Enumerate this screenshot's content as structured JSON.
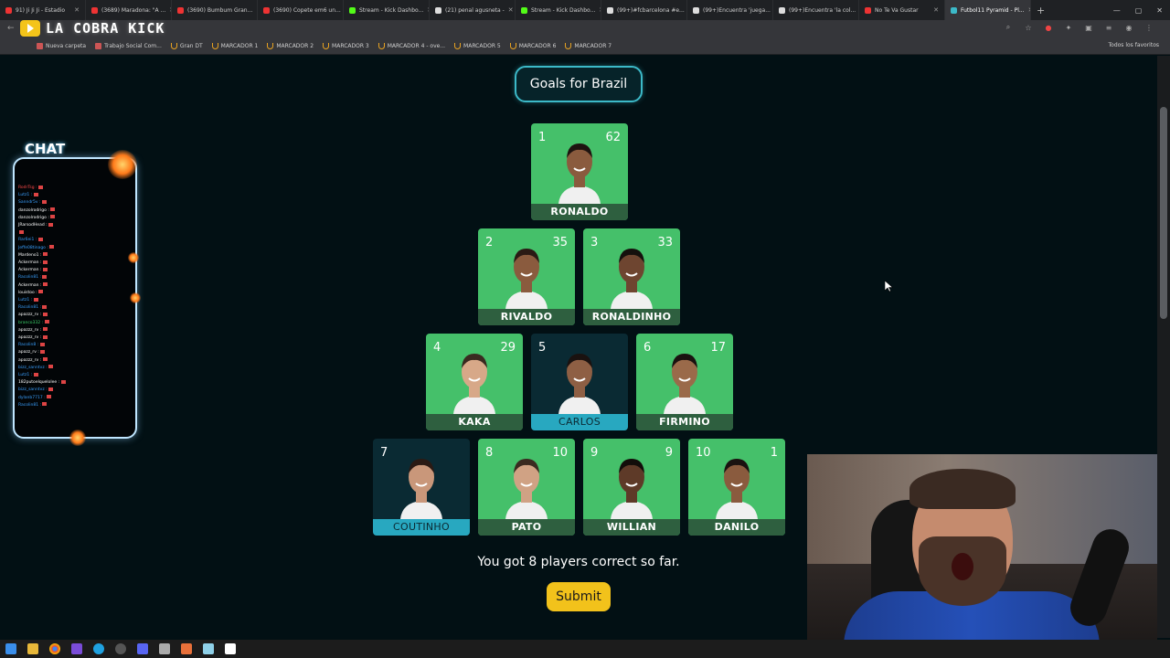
{
  "browser": {
    "tabs": [
      {
        "label": "91) Ji Ji Ji - Estadio",
        "color": "#e33"
      },
      {
        "label": "(3689) Maradona: \"A ...",
        "color": "#e33"
      },
      {
        "label": "(3690) Bumbum Gran...",
        "color": "#e33"
      },
      {
        "label": "(3690) Copete em6 un...",
        "color": "#e33"
      },
      {
        "label": "Stream - Kick Dashbo...",
        "color": "#53fc18"
      },
      {
        "label": "(21) penal agusneta -",
        "color": "#ddd"
      },
      {
        "label": "Stream - Kick Dashbo...",
        "color": "#53fc18"
      },
      {
        "label": "(99+)#fcbarcelona #e...",
        "color": "#ddd"
      },
      {
        "label": "(99+)Encuentra 'juega...",
        "color": "#ddd"
      },
      {
        "label": "(99+)Encuentra 'la col...",
        "color": "#ddd"
      },
      {
        "label": "No Te Va Gustar",
        "color": "#e33"
      },
      {
        "label": "Futbol11 Pyramid - Pl...",
        "color": "#3cb9c8",
        "active": true
      }
    ],
    "bookmarks": [
      "Nueva carpeta",
      "Trabajo Social Com...",
      "Gran DT",
      "MARCADOR 1",
      "MARCADOR 2",
      "MARCADOR 3",
      "MARCADOR 4 - ove...",
      "MARCADOR 5",
      "MARCADOR 6",
      "MARCADOR 7"
    ],
    "all_bookmarks": "Todos los favoritos"
  },
  "overlay": {
    "logo_text": "LA COBRA KICK",
    "chat_title": "CHAT",
    "chat_lines": [
      {
        "user": "RodrTsg :",
        "color": "#ff4a4a"
      },
      {
        "user": "Lutz1 :",
        "color": "#3aa0ff"
      },
      {
        "user": "Sanndr5v :",
        "color": "#3aa0ff"
      },
      {
        "user": "danzolrodrigo :",
        "color": "#ffffff"
      },
      {
        "user": "danzolrodrigo :",
        "color": "#ffffff"
      },
      {
        "user": "JRarsodHead :",
        "color": "#ffffff"
      },
      {
        "user": "",
        "color": "#ffffff"
      },
      {
        "user": "Rar6ei1 :",
        "color": "#3aa0ff"
      },
      {
        "user": "Jeffe08tinago :",
        "color": "#3aa0ff"
      },
      {
        "user": "Mardeno1 :",
        "color": "#ffffff"
      },
      {
        "user": "Ackerman :",
        "color": "#ffffff"
      },
      {
        "user": "Ackerman :",
        "color": "#ffffff"
      },
      {
        "user": "Racolin81 :",
        "color": "#3aa0ff"
      },
      {
        "user": "Ackerman :",
        "color": "#ffffff"
      },
      {
        "user": "louistoo :",
        "color": "#ffffff"
      },
      {
        "user": "Lutz1 :",
        "color": "#3aa0ff"
      },
      {
        "user": "Racolin81 :",
        "color": "#3aa0ff"
      },
      {
        "user": "apazzz_rv :",
        "color": "#ffffff"
      },
      {
        "user": "branco332 :",
        "color": "#3dd46a"
      },
      {
        "user": "apazzz_rv :",
        "color": "#ffffff"
      },
      {
        "user": "apazzz_rv :",
        "color": "#ffffff"
      },
      {
        "user": "Racolin8 :",
        "color": "#3aa0ff"
      },
      {
        "user": "apazz_rv :",
        "color": "#ffffff"
      },
      {
        "user": "apazzz_rv :",
        "color": "#ffffff"
      },
      {
        "user": "bizz_sanntvz :",
        "color": "#3aa0ff"
      },
      {
        "user": "Lutz1 :",
        "color": "#3aa0ff"
      },
      {
        "user": "182putoelquelolee :",
        "color": "#ffffff"
      },
      {
        "user": "bizz_sanntvz :",
        "color": "#3aa0ff"
      },
      {
        "user": "dylanb7717 :",
        "color": "#3aa0ff"
      },
      {
        "user": "Racolin81 :",
        "color": "#3aa0ff"
      }
    ]
  },
  "game": {
    "heading": "Goals for Brazil",
    "players": [
      {
        "number": "1",
        "score": "62",
        "name": "RONALDO",
        "correct": true,
        "skin": "#8a5b3e",
        "hair": "#1e1410"
      },
      {
        "number": "2",
        "score": "35",
        "name": "RIVALDO",
        "correct": true,
        "skin": "#8a5b3e",
        "hair": "#2a1a14"
      },
      {
        "number": "3",
        "score": "33",
        "name": "RONALDINHO",
        "correct": true,
        "skin": "#6e4530",
        "hair": "#15100d"
      },
      {
        "number": "4",
        "score": "29",
        "name": "KAKA",
        "correct": true,
        "skin": "#d7a888",
        "hair": "#3a2a20"
      },
      {
        "number": "5",
        "score": "",
        "name": "CARLOS",
        "correct": false,
        "skin": "#8e5f44",
        "hair": "#1a1210"
      },
      {
        "number": "6",
        "score": "17",
        "name": "FIRMINO",
        "correct": true,
        "skin": "#9a6a4a",
        "hair": "#1a1210"
      },
      {
        "number": "7",
        "score": "",
        "name": "COUTINHO",
        "correct": false,
        "skin": "#c9977a",
        "hair": "#2a1a14"
      },
      {
        "number": "8",
        "score": "10",
        "name": "PATO",
        "correct": true,
        "skin": "#d0a284",
        "hair": "#3a2a20"
      },
      {
        "number": "9",
        "score": "9",
        "name": "WILLIAN",
        "correct": true,
        "skin": "#5e3a28",
        "hair": "#120d0a"
      },
      {
        "number": "10",
        "score": "1",
        "name": "DANILO",
        "correct": true,
        "skin": "#8a5b3e",
        "hair": "#1a1210"
      }
    ],
    "result_text": "You got 8 players correct so far.",
    "submit_label": "Submit"
  },
  "colors": {
    "correct_card": "#45c06a",
    "missed_card": "#0a2a33",
    "missed_label": "#28a8c0",
    "accent": "#3cb9c8",
    "submit": "#f2c21b"
  }
}
